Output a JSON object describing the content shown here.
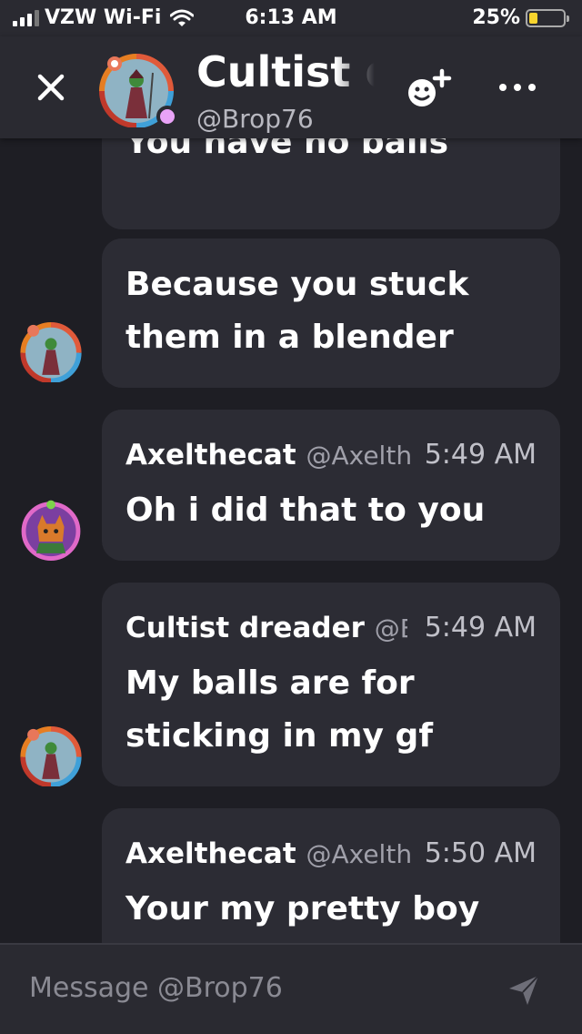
{
  "status_bar": {
    "carrier": "VZW Wi-Fi",
    "time": "6:13 AM",
    "battery_percent": "25%",
    "battery_level": 0.25
  },
  "header": {
    "title": "Cultist dreader",
    "handle": "@Brop76",
    "status_color": "#e9a3f7",
    "icons": [
      "close-icon",
      "add-friend-icon",
      "more-icon"
    ]
  },
  "messages": [
    {
      "author": "",
      "handle": "",
      "time": "",
      "text": "You have no balls",
      "avatar": ""
    },
    {
      "author": "",
      "handle": "",
      "time": "",
      "text": "Because you stuck them in a blender",
      "avatar": "cultist-avatar"
    },
    {
      "author": "Axelthecat",
      "handle": "@Axelth",
      "time": "5:49 AM",
      "text": "Oh i did that to you",
      "avatar": "cat-avatar"
    },
    {
      "author": "Cultist dreader",
      "handle": "@B",
      "time": "5:49 AM",
      "text": "My balls are for sticking in my gf",
      "avatar": "cultist-avatar"
    },
    {
      "author": "Axelthecat",
      "handle": "@Axelth",
      "time": "5:50 AM",
      "text": "Your my pretty boy",
      "avatar": ""
    }
  ],
  "composer": {
    "placeholder": "Message @Brop76"
  },
  "colors": {
    "background": "#1e1e24",
    "bubble": "#2c2c34",
    "bar": "#2a2a31"
  }
}
